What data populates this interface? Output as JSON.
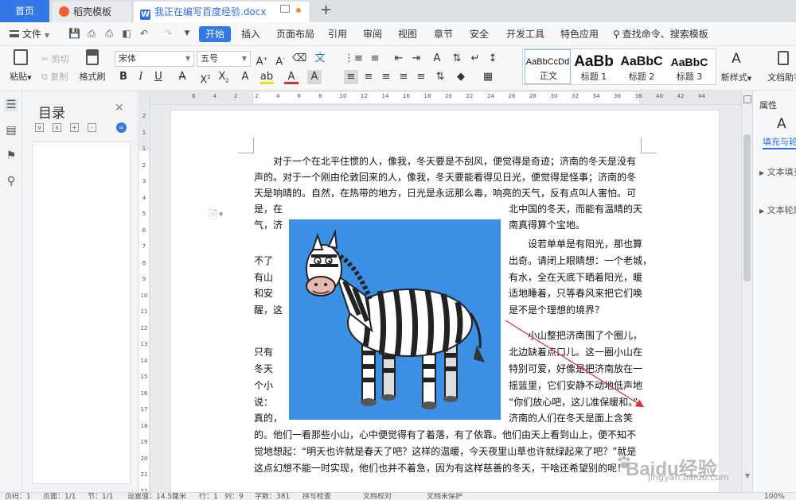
{
  "tabs": [
    {
      "label": "首页"
    },
    {
      "label": "稻壳模板"
    },
    {
      "label": "我正在编写百度经验.docx"
    }
  ],
  "menu": {
    "file": "文件",
    "items": [
      "开始",
      "插入",
      "页面布局",
      "引用",
      "审阅",
      "视图",
      "章节",
      "安全",
      "开发工具",
      "特色应用"
    ],
    "search": "查找命令、搜索模板"
  },
  "ribbon": {
    "paste": "粘贴",
    "cut": "剪切",
    "copy": "复制",
    "format_painter": "格式刷",
    "font_name": "宋体",
    "font_size": "五号",
    "styles": [
      {
        "sample": "AaBbCcDd",
        "name": "正文"
      },
      {
        "sample": "AaBb",
        "name": "标题 1"
      },
      {
        "sample": "AaBbC",
        "name": "标题 2"
      },
      {
        "sample": "AaBbC",
        "name": "标题 3"
      }
    ],
    "new_style": "新样式",
    "assistant": "文档助手"
  },
  "outline": {
    "title": "目录"
  },
  "hruler_numbers": [
    "6",
    "4",
    "2",
    "2",
    "4",
    "6",
    "8",
    "10",
    "12",
    "14",
    "16",
    "18",
    "20",
    "22",
    "24",
    "26",
    "28",
    "30",
    "32",
    "34",
    "36",
    "38",
    "40",
    "42",
    "44"
  ],
  "vruler_numbers": [
    "2",
    "1",
    "1",
    "2",
    "3",
    "4",
    "5",
    "6",
    "7",
    "8",
    "9",
    "10",
    "11",
    "12",
    "13",
    "14",
    "15",
    "16",
    "17",
    "18",
    "19",
    "20",
    "21",
    "22"
  ],
  "document": {
    "lines": [
      "　　对于一个在北平住惯的人，像我，冬天要是不刮风，便觉得是奇迹；济南的冬天是没有",
      "声的。对于一个刚由伦敦回来的人，像我，冬天要能看得见日光，便觉得是怪事；济南的冬",
      "天是响晴的。自然，在热带的地方，日光是永远那么毒，响亮的天气，反有点叫人害怕。可",
      "是，在",
      "北中国的冬天，而能有温晴的天",
      "气，济",
      "南真得算个宝地。",
      "　　设若单单是有阳光，那也算",
      "不了",
      "出奇。请闭上眼睛想：一个老城，",
      "有山",
      "有水，全在天底下晒着阳光，暖",
      "和安",
      "适地睡着，只等春风来把它们唤",
      "醒，这",
      "是不是个理想的境界？",
      "　　小山整把济南围了个圈儿，",
      "只有",
      "北边缺着点口儿。这一圈小山在",
      "冬天",
      "特别可爱，好像是把济南放在一",
      "个小",
      "摇篮里，它们安静不动地低声地",
      "说：",
      "“你们放心吧，这儿准保暖和。”",
      "真的，",
      "济南的人们在冬天是面上含笑",
      "的。他们一看那些小山，心中便觉得有了着落，有了依靠。他们由天上看到山上，便不知不",
      "觉地想起：“明天也许就是春天了吧？这样的温暖，今天夜里山草也许就绿起来了吧？”就是",
      "这点幻想不能一时实现，他们也并不着急，因为有这样慈善的冬天，干啥还希望别的呢！"
    ]
  },
  "rightpanel": {
    "title": "属性",
    "tab": "填充与轮廓",
    "item1": "文本填充",
    "item2": "文本轮廓"
  },
  "status": {
    "page": "页码：1",
    "pages": "页面：1/1",
    "section": "节：1/1",
    "position": "设置值：14.5厘米",
    "row": "行：1",
    "col": "列：9",
    "words": "字数：381",
    "spell": "拼写检查",
    "proof": "文档校对",
    "protect": "文档未保护",
    "zoom": "100%"
  },
  "watermark": {
    "text": "Baidu经验",
    "url": "jingyan.baidu.com"
  },
  "colors": {
    "accent": "#3478e8",
    "image_bg": "#3b8fe5",
    "arrow": "#e0303a"
  }
}
